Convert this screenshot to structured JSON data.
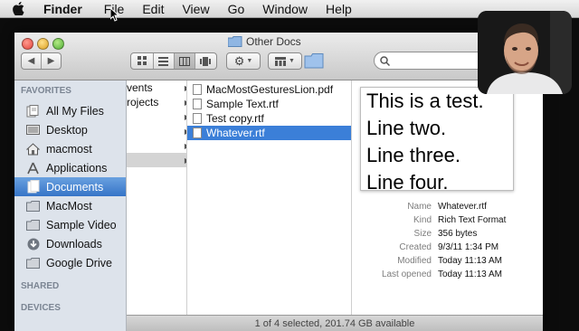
{
  "menubar": {
    "app_name": "Finder",
    "items": [
      "File",
      "Edit",
      "View",
      "Go",
      "Window",
      "Help"
    ]
  },
  "window": {
    "title": "Other Docs",
    "sidebar": {
      "favorites_heading": "FAVORITES",
      "items": [
        {
          "label": "All My Files",
          "icon": "all-files-icon"
        },
        {
          "label": "Desktop",
          "icon": "desktop-icon"
        },
        {
          "label": "macmost",
          "icon": "home-icon"
        },
        {
          "label": "Applications",
          "icon": "applications-icon"
        },
        {
          "label": "Documents",
          "icon": "documents-icon",
          "selected": true
        },
        {
          "label": "MacMost",
          "icon": "folder-icon"
        },
        {
          "label": "Sample Video",
          "icon": "folder-icon"
        },
        {
          "label": "Downloads",
          "icon": "downloads-icon"
        },
        {
          "label": "Google Drive",
          "icon": "folder-icon"
        }
      ],
      "shared_heading": "SHARED",
      "devices_heading": "DEVICES"
    },
    "column1": [
      "vents",
      "rojects",
      "",
      "",
      "",
      ""
    ],
    "column2": [
      {
        "name": "MacMostGesturesLion.pdf"
      },
      {
        "name": "Sample Text.rtf"
      },
      {
        "name": "Test copy.rtf"
      },
      {
        "name": "Whatever.rtf",
        "selected": true
      }
    ],
    "preview": {
      "lines": [
        "This is a test.",
        "Line two.",
        "Line three.",
        "Line four."
      ],
      "info": [
        {
          "key": "Name",
          "value": "Whatever.rtf"
        },
        {
          "key": "Kind",
          "value": "Rich Text Format"
        },
        {
          "key": "Size",
          "value": "356 bytes"
        },
        {
          "key": "Created",
          "value": "9/3/11 1:34 PM"
        },
        {
          "key": "Modified",
          "value": "Today 11:13 AM"
        },
        {
          "key": "Last opened",
          "value": "Today 11:13 AM"
        }
      ]
    },
    "status": "1 of 4 selected, 201.74 GB available"
  },
  "colors": {
    "selection": "#3b7fd8",
    "sidebar_bg": "#dde3eb"
  }
}
